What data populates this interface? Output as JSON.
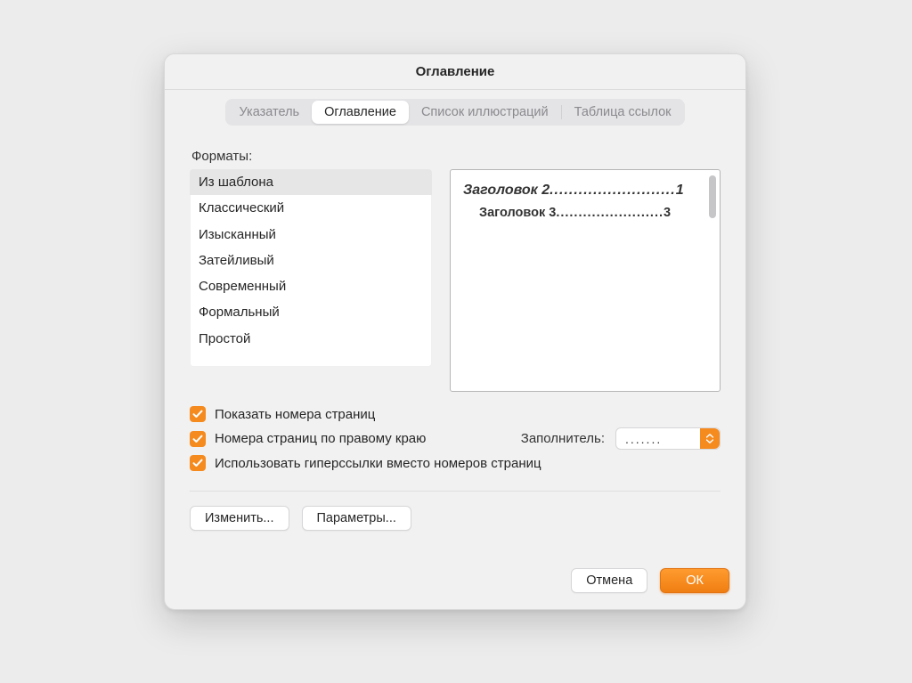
{
  "dialog": {
    "title": "Оглавление"
  },
  "tabs": {
    "items": [
      {
        "label": "Указатель",
        "active": false
      },
      {
        "label": "Оглавление",
        "active": true
      },
      {
        "label": "Список иллюстраций",
        "active": false
      },
      {
        "label": "Таблица ссылок",
        "active": false
      }
    ]
  },
  "formats": {
    "label": "Форматы:",
    "items": [
      "Из шаблона",
      "Классический",
      "Изысканный",
      "Затейливый",
      "Современный",
      "Формальный",
      "Простой"
    ],
    "selected_index": 0
  },
  "preview": {
    "lines": [
      {
        "title": "Заголовок 2",
        "leader": " ..........................",
        "page": " 1"
      },
      {
        "title": "Заголовок 3",
        "leader": "........................",
        "page": " 3"
      }
    ]
  },
  "options": {
    "show_page_numbers": "Показать номера страниц",
    "right_align": "Номера страниц по правому краю",
    "hyperlinks": "Использовать гиперссылки вместо номеров страниц",
    "leader_label": "Заполнитель:",
    "leader_value": "......."
  },
  "buttons": {
    "modify": "Изменить...",
    "options": "Параметры...",
    "cancel": "Отмена",
    "ok": "ОК"
  }
}
